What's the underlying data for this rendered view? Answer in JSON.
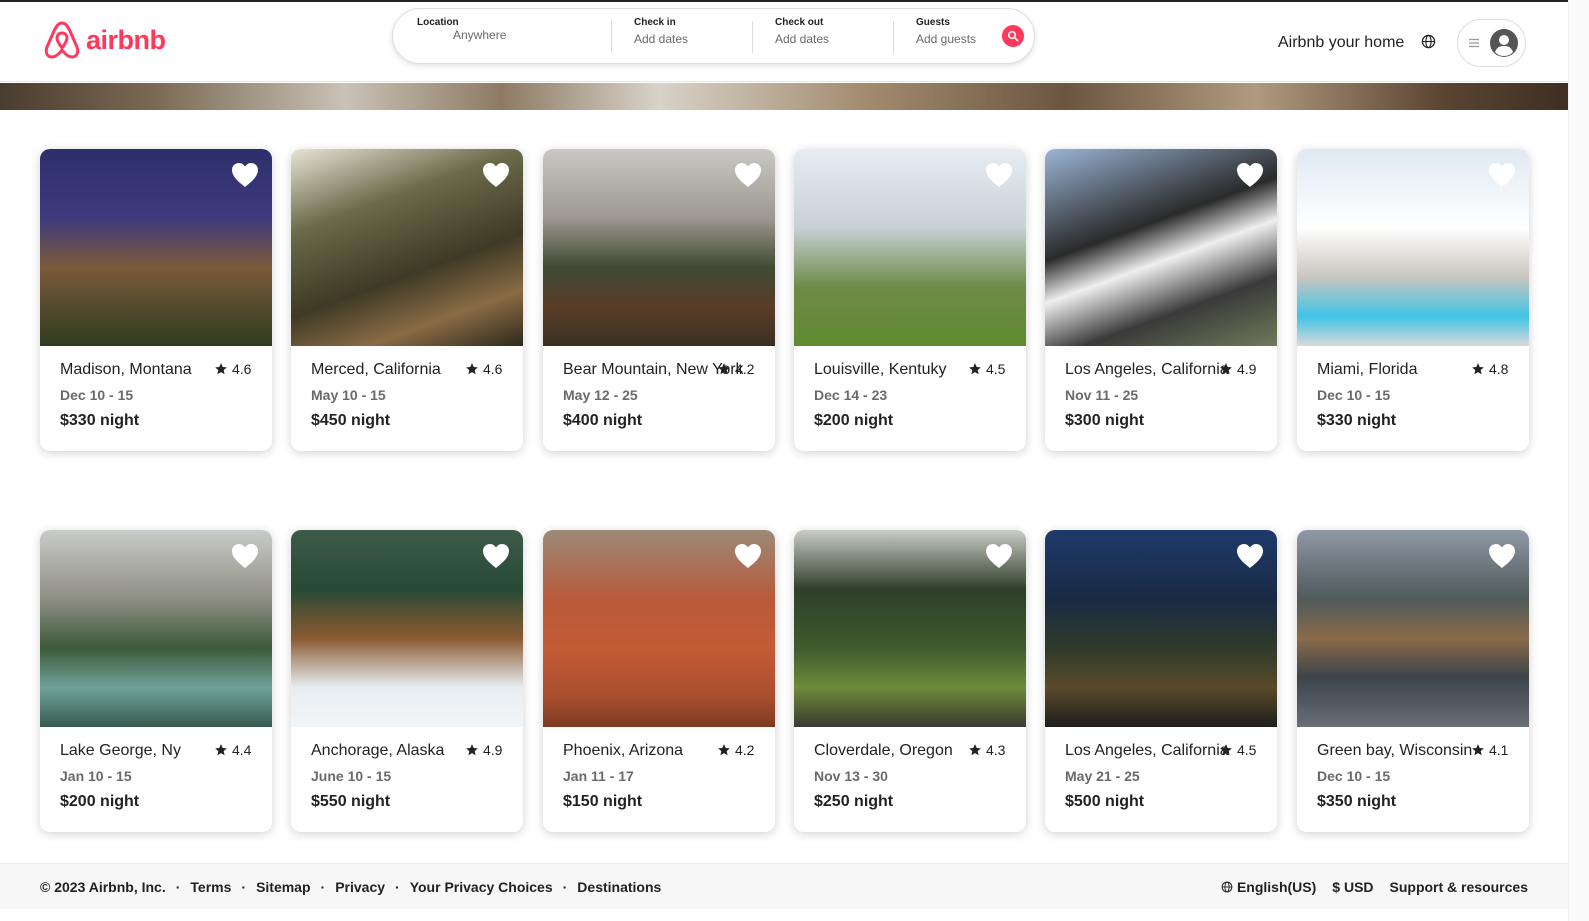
{
  "header": {
    "logo_text": "airbnb",
    "search": {
      "location_label": "Location",
      "location_value": "Anywhere",
      "checkin_label": "Check in",
      "checkin_value": "Add dates",
      "checkout_label": "Check out",
      "checkout_value": "Add dates",
      "guests_label": "Guests",
      "guests_value": "Add guests"
    },
    "host_link": "Airbnb your home"
  },
  "colors": {
    "brand": "#ff385c",
    "text": "#222222",
    "muted": "#6a6a6a"
  },
  "listings": [
    {
      "location": "Madison, Montana",
      "rating": "4.6",
      "dates": "Dec 10 - 15",
      "price": "$330 night",
      "photo": "purple-lit-house"
    },
    {
      "location": "Merced, California",
      "rating": "4.6",
      "dates": "May 10 - 15",
      "price": "$450 night",
      "photo": "forest-cabin"
    },
    {
      "location": "Bear Mountain, New York",
      "rating": "4.2",
      "dates": "May 12 - 25",
      "price": "$400 night",
      "photo": "log-cabin-mountain"
    },
    {
      "location": "Louisville, Kentuky",
      "rating": "4.5",
      "dates": "Dec 14 - 23",
      "price": "$200 night",
      "photo": "white-farmhouse"
    },
    {
      "location": "Los Angeles, California",
      "rating": "4.9",
      "dates": "Nov 11 - 25",
      "price": "$300 night",
      "photo": "modern-house"
    },
    {
      "location": "Miami, Florida",
      "rating": "4.8",
      "dates": "Dec 10 - 15",
      "price": "$330 night",
      "photo": "pool-villa"
    },
    {
      "location": "Lake George, Ny",
      "rating": "4.4",
      "dates": "Jan 10 - 15",
      "price": "$200 night",
      "photo": "lake-mountains"
    },
    {
      "location": "Anchorage, Alaska",
      "rating": "4.9",
      "dates": "June 10 - 15",
      "price": "$550 night",
      "photo": "snow-treehouse"
    },
    {
      "location": "Phoenix, Arizona",
      "rating": "4.2",
      "dates": "Jan 11 - 17",
      "price": "$150 night",
      "photo": "red-canyon-yurt"
    },
    {
      "location": "Cloverdale, Oregon",
      "rating": "4.3",
      "dates": "Nov 13 - 30",
      "price": "$250 night",
      "photo": "forest-river"
    },
    {
      "location": "Los Angeles, California",
      "rating": "4.5",
      "dates": "May 21 - 25",
      "price": "$500 night",
      "photo": "night-restaurant"
    },
    {
      "location": "Green bay, Wisconsin",
      "rating": "4.1",
      "dates": "Dec 10 - 15",
      "price": "$350 night",
      "photo": "winter-lake-cabin"
    }
  ],
  "footer": {
    "copyright": "© 2023 Airbnb, Inc.",
    "links": [
      "Terms",
      "Sitemap",
      "Privacy",
      "Your Privacy Choices",
      "Destinations"
    ],
    "language": "English(US)",
    "currency": "$ USD",
    "support": "Support & resources"
  }
}
